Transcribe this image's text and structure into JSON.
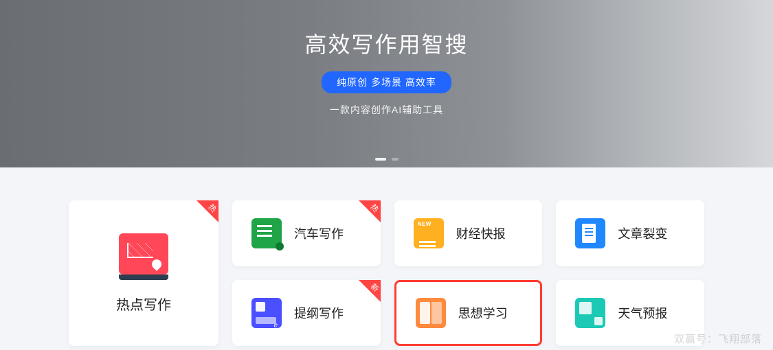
{
  "hero": {
    "title": "高效写作用智搜",
    "badge": "纯原创 多场景 高效率",
    "subtitle": "一款内容创作AI辅助工具"
  },
  "featured": {
    "label": "热点写作",
    "ribbon": "热"
  },
  "cards": [
    {
      "label": "汽车写作",
      "ribbon": "热",
      "icon": "green"
    },
    {
      "label": "财经快报",
      "ribbon": "",
      "icon": "yellow"
    },
    {
      "label": "文章裂变",
      "ribbon": "",
      "icon": "lblue"
    },
    {
      "label": "提纲写作",
      "ribbon": "新",
      "icon": "purple"
    },
    {
      "label": "思想学习",
      "ribbon": "",
      "icon": "orange",
      "selected": true
    },
    {
      "label": "天气预报",
      "ribbon": "",
      "icon": "teal"
    }
  ],
  "watermark": "双赢号：飞翔部落"
}
